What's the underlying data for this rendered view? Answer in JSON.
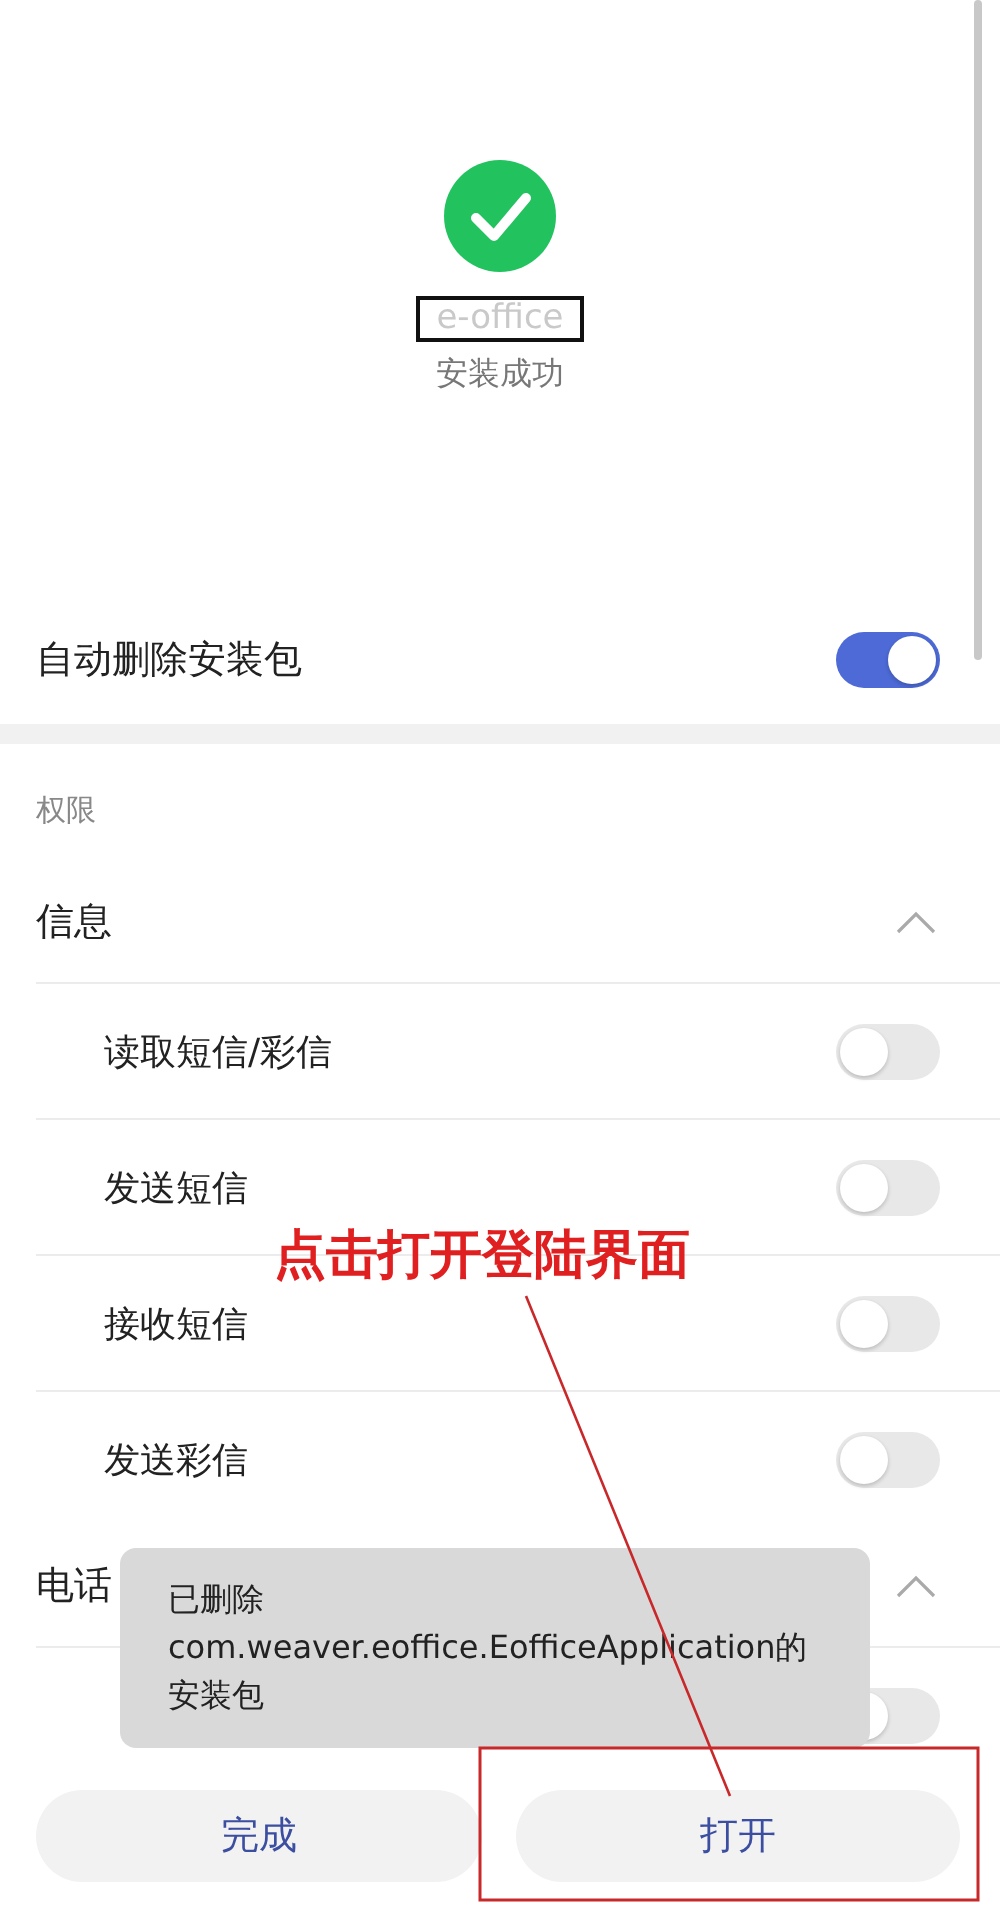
{
  "install": {
    "app_name": "e-office",
    "status": "安装成功"
  },
  "auto_delete": {
    "label": "自动删除安装包",
    "on": true
  },
  "permissions": {
    "title": "权限",
    "groups": [
      {
        "name": "信息",
        "expanded": true,
        "items": [
          {
            "label": "读取短信/彩信",
            "on": false
          },
          {
            "label": "发送短信",
            "on": false
          },
          {
            "label": "接收短信",
            "on": false
          },
          {
            "label": "发送彩信",
            "on": false
          }
        ]
      },
      {
        "name": "电话",
        "expanded": true,
        "items": [
          {
            "on": false
          }
        ]
      }
    ]
  },
  "toast": "已删除com.weaver.eoffice.EofficeApplication的安装包",
  "buttons": [
    {
      "label": "完成"
    },
    {
      "label": "打开"
    }
  ],
  "annotation": {
    "text": "点击打开登陆界面"
  }
}
